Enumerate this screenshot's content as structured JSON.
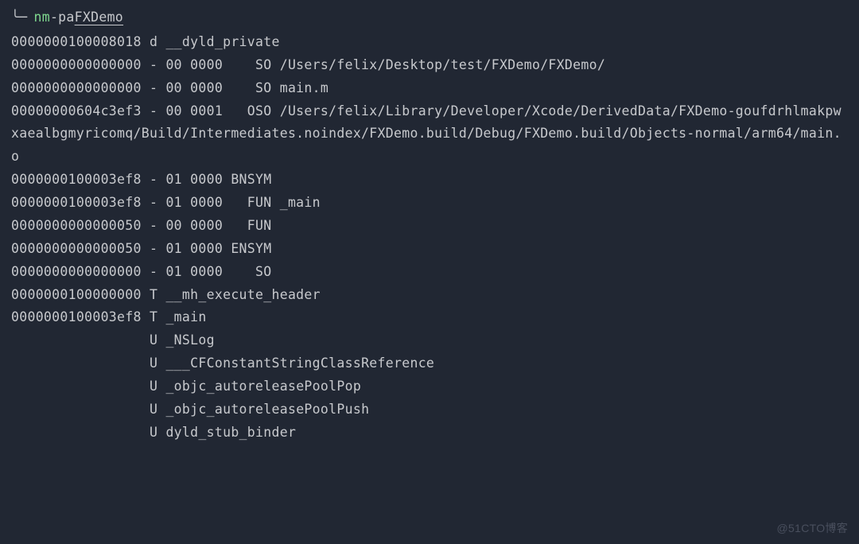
{
  "prompt": {
    "branch_char": "╰─",
    "command_name": "nm",
    "command_args": " -pa ",
    "command_target": "FXDemo"
  },
  "output_lines": [
    "0000000100008018 d __dyld_private",
    "0000000000000000 - 00 0000    SO /Users/felix/Desktop/test/FXDemo/FXDemo/",
    "0000000000000000 - 00 0000    SO main.m",
    "00000000604c3ef3 - 00 0001   OSO /Users/felix/Library/Developer/Xcode/DerivedData/FXDemo-goufdrhlmakpwxaealbgmyricomq/Build/Intermediates.noindex/FXDemo.build/Debug/FXDemo.build/Objects-normal/arm64/main.o",
    "0000000100003ef8 - 01 0000 BNSYM ",
    "0000000100003ef8 - 01 0000   FUN _main",
    "0000000000000050 - 00 0000   FUN ",
    "0000000000000050 - 01 0000 ENSYM ",
    "0000000000000000 - 01 0000    SO ",
    "0000000100000000 T __mh_execute_header",
    "0000000100003ef8 T _main",
    "                 U _NSLog",
    "                 U ___CFConstantStringClassReference",
    "                 U _objc_autoreleasePoolPop",
    "                 U _objc_autoreleasePoolPush",
    "                 U dyld_stub_binder"
  ],
  "watermark": "@51CTO博客"
}
